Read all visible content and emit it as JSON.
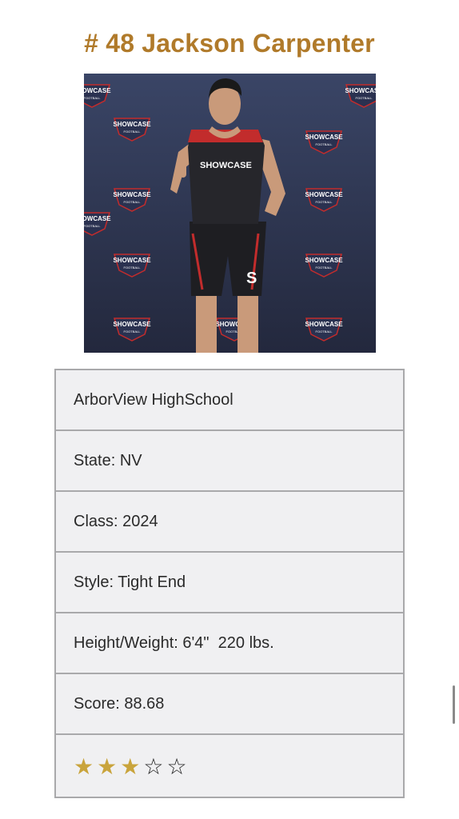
{
  "player": {
    "title": "# 48 Jackson Carpenter",
    "photo_icon": "player-photo",
    "backdrop_text": "SHOWCASE",
    "backdrop_sub": "FOOTBALL",
    "jersey_text": "SHOWCASE",
    "jersey_logo": "S"
  },
  "details": {
    "school": "ArborView HighSchool",
    "state": "State: NV",
    "class": "Class: 2024",
    "style": "Style: Tight End",
    "height_weight": "Height/Weight: 6'4\"  220 lbs.",
    "score": "Score: 88.68",
    "rating": {
      "filled": 3,
      "total": 5,
      "filled_color": "#c9a43c",
      "empty_color": "#222222"
    }
  }
}
